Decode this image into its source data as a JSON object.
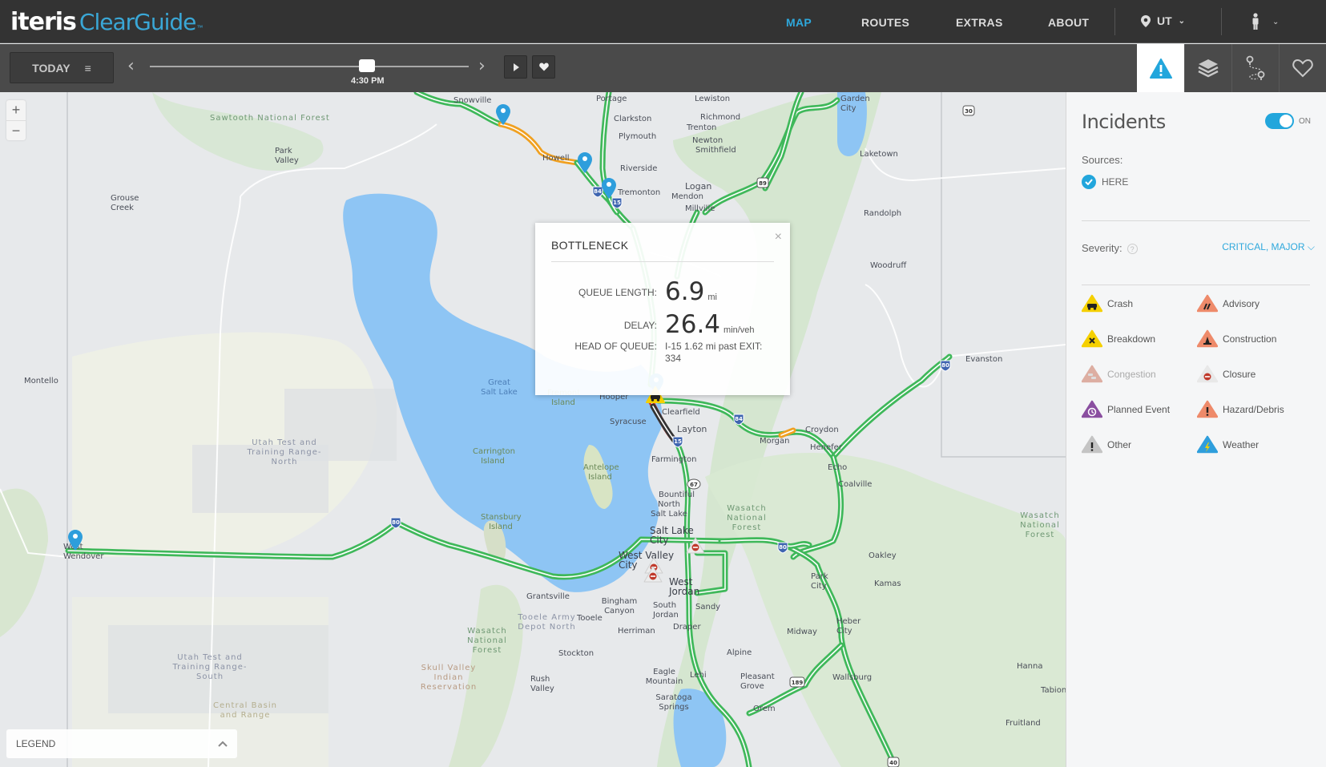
{
  "header": {
    "logo_brand": "iteris",
    "logo_product": "ClearGuide",
    "logo_tm": "™",
    "nav": [
      {
        "label": "MAP",
        "active": true
      },
      {
        "label": "ROUTES",
        "active": false
      },
      {
        "label": "EXTRAS",
        "active": false
      },
      {
        "label": "ABOUT",
        "active": false
      }
    ],
    "region": "UT"
  },
  "toolbar": {
    "date_label": "TODAY",
    "time_label": "4:30 PM",
    "time_slider_fraction": 0.68
  },
  "panel_tabs": [
    {
      "name": "incidents",
      "icon": "warning-icon",
      "active": true
    },
    {
      "name": "layers",
      "icon": "layers-icon",
      "active": false
    },
    {
      "name": "routes",
      "icon": "route-icon",
      "active": false
    },
    {
      "name": "favorites",
      "icon": "heart-icon",
      "active": false
    }
  ],
  "map": {
    "zoom_in": "+",
    "zoom_out": "−",
    "legend_label": "LEGEND",
    "popup": {
      "title": "BOTTLENECK",
      "close": "×",
      "queue_length_label": "QUEUE LENGTH:",
      "queue_length_value": "6.9",
      "queue_length_unit": "mi",
      "delay_label": "DELAY:",
      "delay_value": "26.4",
      "delay_unit": "min/veh",
      "head_label": "HEAD OF QUEUE:",
      "head_value": "I-15 1.62 mi past EXIT: 334"
    },
    "labels": {
      "sawtooth": "Sawtooth National Forest",
      "park_valley": "Park Valley",
      "grouse_creek": "Grouse Creek",
      "montello": "Montello",
      "utah_test_north": "Utah Test and Training Range-North",
      "utah_test_south": "Utah Test and Training Range-South",
      "central_basin": "Central Basin and Range",
      "wendover": "West Wendover",
      "snowville": "Snowville",
      "portage": "Portage",
      "lewiston": "Lewiston",
      "clarkston": "Clarkston",
      "richmond": "Richmond",
      "trenton": "Trenton",
      "plymouth": "Plymouth",
      "newton": "Newton",
      "smithfield": "Smithfield",
      "howell": "Howell",
      "riverside": "Riverside",
      "tremonton": "Tremonton",
      "logan": "Logan",
      "mendon": "Mendon",
      "millville": "Millville",
      "garden_city": "Garden City",
      "laketown": "Laketown",
      "randolph": "Randolph",
      "woodruff": "Woodruff",
      "evanston": "Evanston",
      "great_salt_lake": "Great Salt Lake",
      "fremont_island": "Fremont Island",
      "hooper": "Hooper",
      "syracuse": "Syracuse",
      "clearfield": "Clearfield",
      "layton": "Layton",
      "farmington": "Farmington",
      "morgan": "Morgan",
      "croydon": "Croydon",
      "henefer": "Henefer",
      "echo": "Echo",
      "coalville": "Coalville",
      "carrington_island": "Carrington Island",
      "antelope_island": "Antelope Island",
      "stansbury_island": "Stansbury Island",
      "bountiful": "Bountiful",
      "north_salt_lake": "North Salt Lake",
      "salt_lake_city": "Salt Lake City",
      "west_valley": "West Valley City",
      "west_jordan": "West Jordan",
      "south_jordan": "South Jordan",
      "sandy": "Sandy",
      "draper": "Draper",
      "bingham": "Bingham Canyon",
      "herriman": "Herriman",
      "grantsville": "Grantsville",
      "tooele": "Tooele",
      "tooele_army": "Tooele Army Depot North",
      "stockton": "Stockton",
      "rush_valley": "Rush Valley",
      "eagle_mountain": "Eagle Mountain",
      "saratoga": "Saratoga Springs",
      "lehi": "Lehi",
      "alpine": "Alpine",
      "pleasant_grove": "Pleasant Grove",
      "orem": "Orem",
      "midway": "Midway",
      "heber": "Heber City",
      "park_city": "Park City",
      "oakley": "Oakley",
      "kamas": "Kamas",
      "wallsburg": "Wallsburg",
      "hanna": "Hanna",
      "tabiona": "Tabiona",
      "fruitland": "Fruitland",
      "wasatch_nf_1": "Wasatch National Forest",
      "wasatch_nf_2": "Wasatch National Forest",
      "wasatch_nf_3": "Wasatch National Forest",
      "skull_valley": "Skull Valley Indian Reservation"
    },
    "shields": {
      "i80_a": "80",
      "i80_b": "80",
      "i80_c": "80",
      "i84_a": "84",
      "i84_b": "84",
      "i15_a": "15",
      "i15_b": "15",
      "us89": "89",
      "us30": "30",
      "us189": "189",
      "us40": "40",
      "sr67": "67"
    }
  },
  "sidebar": {
    "title": "Incidents",
    "toggle_state": "ON",
    "sources_label": "Sources:",
    "source": "HERE",
    "severity_label": "Severity:",
    "severity_help": "?",
    "severity_value": "CRITICAL, MAJOR",
    "incident_types": [
      {
        "label": "Crash",
        "icon": "crash-icon",
        "color": "#f5d000",
        "enabled": true
      },
      {
        "label": "Advisory",
        "icon": "advisory-icon",
        "color": "#ee8a6a",
        "enabled": true
      },
      {
        "label": "Breakdown",
        "icon": "breakdown-icon",
        "color": "#f5d000",
        "enabled": true
      },
      {
        "label": "Construction",
        "icon": "construction-icon",
        "color": "#ee8a6a",
        "enabled": true
      },
      {
        "label": "Congestion",
        "icon": "congestion-icon",
        "color": "#d4917f",
        "enabled": false
      },
      {
        "label": "Closure",
        "icon": "closure-icon",
        "color": "#e8e8e8",
        "enabled": true
      },
      {
        "label": "Planned Event",
        "icon": "planned-event-icon",
        "color": "#8a4fa0",
        "enabled": true
      },
      {
        "label": "Hazard/Debris",
        "icon": "hazard-icon",
        "color": "#ee8a6a",
        "enabled": true
      },
      {
        "label": "Other",
        "icon": "other-icon",
        "color": "#c4c4c4",
        "enabled": true
      },
      {
        "label": "Weather",
        "icon": "weather-icon",
        "color": "#2e9edc",
        "enabled": true
      }
    ]
  },
  "colors": {
    "accent": "#2ea8dc",
    "header_bg": "#333333",
    "toolbar_bg": "#4a4a4a",
    "road_free": "#3fb85a",
    "road_slow": "#f0a020",
    "road_congested": "#d8322a",
    "road_stopped": "#333333",
    "water": "#8ec5f4"
  }
}
